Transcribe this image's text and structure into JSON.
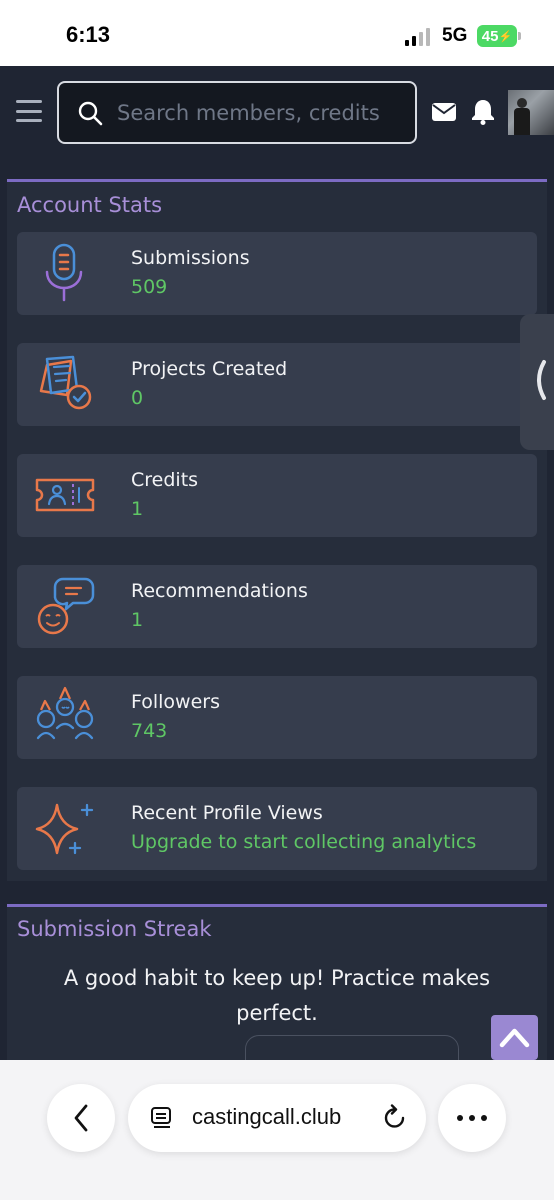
{
  "status_bar": {
    "time": "6:13",
    "network": "5G",
    "battery": "45"
  },
  "header": {
    "search_placeholder": "Search members, credits",
    "icons": [
      "menu-icon",
      "search-icon",
      "mail-icon",
      "bell-icon"
    ]
  },
  "account_stats": {
    "title": "Account Stats",
    "items": [
      {
        "label": "Submissions",
        "value": "509",
        "icon": "microphone-icon"
      },
      {
        "label": "Projects Created",
        "value": "0",
        "icon": "clipboard-check-icon"
      },
      {
        "label": "Credits",
        "value": "1",
        "icon": "ticket-icon"
      },
      {
        "label": "Recommendations",
        "value": "1",
        "icon": "speech-bubble-face-icon"
      },
      {
        "label": "Followers",
        "value": "743",
        "icon": "party-people-icon"
      },
      {
        "label": "Recent Profile Views",
        "value": "Upgrade to start collecting analytics",
        "icon": "sparkle-icon"
      }
    ]
  },
  "submission_streak": {
    "title": "Submission Streak",
    "text": "A good habit to keep up! Practice makes perfect."
  },
  "browser": {
    "url": "castingcall.club"
  },
  "colors": {
    "accent": "#7c6bc3",
    "title": "#a88fd8",
    "value_green": "#5fc765",
    "background": "#1f2533",
    "card": "#363d4d",
    "icon_orange": "#e8784a",
    "icon_blue": "#4a8fd8"
  }
}
